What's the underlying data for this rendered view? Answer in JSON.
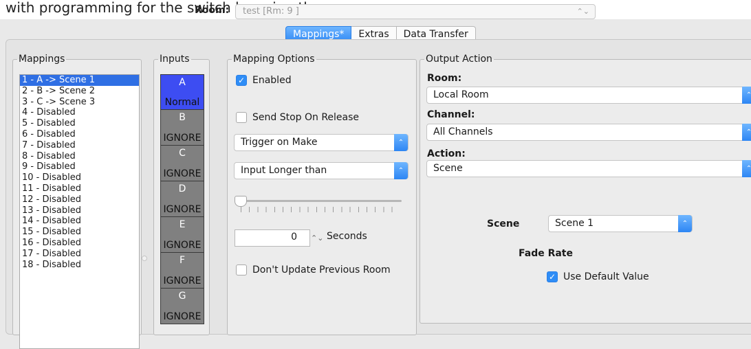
{
  "top": {
    "clipped_text": "with programming for the switch by using the gear:"
  },
  "header": {
    "room_label": "Room:",
    "room_value": "test [Rm: 9 ]"
  },
  "tabs": [
    {
      "label": "Mappings*",
      "active": true
    },
    {
      "label": "Extras",
      "active": false
    },
    {
      "label": "Data Transfer",
      "active": false
    }
  ],
  "mappings": {
    "title": "Mappings",
    "items": [
      "1 - A -> Scene 1",
      "2 - B -> Scene 2",
      "3 - C -> Scene 3",
      "4 - Disabled",
      "5 - Disabled",
      "6 - Disabled",
      "7 - Disabled",
      "8 - Disabled",
      "9 - Disabled",
      "10 - Disabled",
      "11 - Disabled",
      "12 - Disabled",
      "13 - Disabled",
      "14 - Disabled",
      "15 - Disabled",
      "16 - Disabled",
      "17 - Disabled",
      "18 - Disabled"
    ],
    "selected_index": 0
  },
  "inputs": {
    "title": "Inputs",
    "items": [
      {
        "letter": "A",
        "mode": "Normal",
        "active": true
      },
      {
        "letter": "B",
        "mode": "IGNORE",
        "active": false
      },
      {
        "letter": "C",
        "mode": "IGNORE",
        "active": false
      },
      {
        "letter": "D",
        "mode": "IGNORE",
        "active": false
      },
      {
        "letter": "E",
        "mode": "IGNORE",
        "active": false
      },
      {
        "letter": "F",
        "mode": "IGNORE",
        "active": false
      },
      {
        "letter": "G",
        "mode": "IGNORE",
        "active": false
      }
    ]
  },
  "options": {
    "title": "Mapping Options",
    "enabled_label": "Enabled",
    "enabled_checked": true,
    "stop_label": "Send Stop On Release",
    "stop_checked": false,
    "trigger_value": "Trigger on Make",
    "duration_value": "Input Longer than",
    "seconds_value": "0",
    "seconds_label": "Seconds",
    "dont_update_label": "Don't Update Previous Room",
    "dont_update_checked": false
  },
  "output": {
    "title": "Output Action",
    "room_label": "Room:",
    "room_value": "Local Room",
    "channel_label": "Channel:",
    "channel_value": "All Channels",
    "action_label": "Action:",
    "action_value": "Scene",
    "scene_label": "Scene",
    "scene_value": "Scene 1",
    "fade_label": "Fade Rate",
    "use_default_label": "Use Default Value",
    "use_default_checked": true
  },
  "colors": {
    "accent": "#2f8df6",
    "selected_row": "#2f6fe4",
    "input_active": "#3d4df2",
    "input_idle": "#808080"
  },
  "icons": [
    "updown-chevron-icon",
    "checkmark-icon",
    "resize-grip-icon"
  ]
}
